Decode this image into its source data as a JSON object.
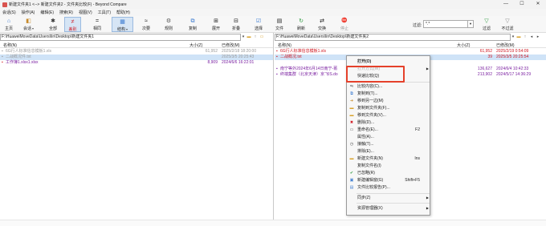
{
  "window": {
    "title": "新建文件夹1 <--> 新建文件夹2 - 文件夹比较(F) - Beyond Compare",
    "minimize": "—",
    "maximize": "☐",
    "close": "✕"
  },
  "menu": [
    "会话(S)",
    "操作(A)",
    "编辑(E)",
    "搜索(R)",
    "视图(V)",
    "工具(T)",
    "帮助(H)"
  ],
  "toolbar": [
    {
      "label": "主页",
      "icon": "home-icon",
      "glyph": "⌂"
    },
    {
      "label": "会话",
      "icon": "session-icon",
      "glyph": "◧",
      "caret": true
    },
    {
      "label": "全部",
      "icon": "all-icon",
      "glyph": "✱"
    },
    {
      "label": "差别",
      "icon": "diff-icon",
      "glyph": "≠",
      "active": true
    },
    {
      "label": "相同",
      "icon": "same-icon",
      "glyph": "="
    },
    {
      "label": "结构",
      "icon": "structure-icon",
      "glyph": "▦",
      "caret": true
    },
    {
      "label": "次要",
      "icon": "minor-icon",
      "glyph": "≈"
    },
    {
      "label": "规则",
      "icon": "rules-icon",
      "glyph": "⚙"
    },
    {
      "label": "复制",
      "icon": "copy-icon",
      "glyph": "⧉"
    },
    {
      "label": "展开",
      "icon": "expand-icon",
      "glyph": "⊞"
    },
    {
      "label": "折叠",
      "icon": "collapse-icon",
      "glyph": "⊟"
    },
    {
      "label": "选择",
      "icon": "select-icon",
      "glyph": "☑"
    },
    {
      "label": "文件",
      "icon": "files-icon",
      "glyph": "▤"
    },
    {
      "label": "刷新",
      "icon": "refresh-icon",
      "glyph": "↻"
    },
    {
      "label": "交换",
      "icon": "swap-icon",
      "glyph": "⇄"
    },
    {
      "label": "停止",
      "icon": "stop-icon",
      "glyph": "⛔"
    },
    {
      "label": "过滤",
      "icon": "filter-icon",
      "glyph": "▽"
    },
    {
      "label": "不过滤",
      "icon": "unfilter-icon",
      "glyph": "▽"
    }
  ],
  "filter": {
    "label": "过滤:",
    "value": "*.*",
    "dropdown": "▼"
  },
  "left": {
    "path": "F:\\HuaweiMoveData\\Users\\lin\\Desktop\\新建文件夹1",
    "headers": {
      "name": "名称(N)",
      "size": "大小(Z)",
      "modified": "已修改(M)"
    },
    "rows": [
      {
        "name": "6G行人标准信息模板1.xls",
        "size": "61,952",
        "modified": "2025/2/18 18:20:00",
        "color": "gray"
      },
      {
        "name": "二战概况件.txt",
        "size": "",
        "modified": "2025/3/5 20:25:43",
        "color": "gray",
        "selected": true
      },
      {
        "name": "工作簿1.xlsx1.xlsx",
        "size": "8,909",
        "modified": "2024/6/6 16:22:01",
        "color": "purple"
      }
    ]
  },
  "right": {
    "path": "F:\\HuaweiMoveData\\Users\\lin\\Desktop\\新建文件夹2",
    "headers": {
      "name": "名称(N)",
      "size": "大小(Z)",
      "modified": "已修改(M)"
    },
    "rows": [
      {
        "name": "6G行人标准信息模板1.xls",
        "size": "61,952",
        "modified": "2025/2/19 0:54:09",
        "color": "red"
      },
      {
        "name": "二战概况.txt",
        "size": "39",
        "modified": "2025/3/5 20:25:54",
        "color": "red",
        "selected": true
      },
      {
        "name": "南宁等外2024年6月14日南宁-莆",
        "size": "136,627",
        "modified": "2024/6/4 10:42:33",
        "color": "purple"
      },
      {
        "name": "终端集群（北京天津）京飞IS.do",
        "size": "213,902",
        "modified": "2024/5/17 14:36:29",
        "color": "purple"
      }
    ]
  },
  "context_menu": [
    {
      "label": "打开(O)",
      "bold": true
    },
    {
      "label": "打开方式(W)",
      "arrow": true,
      "disabled": true
    },
    {
      "label": "快速比较(Q)"
    },
    {
      "sep": true
    },
    {
      "label": "比较内容(C)...",
      "icon": "compare-icon"
    },
    {
      "label": "复制到(T)...",
      "icon": "copy-to-icon"
    },
    {
      "label": "移到另一边(M)",
      "icon": "move-other-icon"
    },
    {
      "label": "复制到文件夹(F)...",
      "icon": "copy-folder-icon"
    },
    {
      "label": "移到文件夹(V)...",
      "icon": "move-folder-icon"
    },
    {
      "label": "删除(D)...",
      "icon": "delete-icon"
    },
    {
      "label": "重命名(E)...",
      "shortcut": "F2",
      "icon": "rename-icon"
    },
    {
      "label": "属性(A)..."
    },
    {
      "label": "接触(T)...",
      "icon": "touch-icon"
    },
    {
      "label": "排除(E)..."
    },
    {
      "label": "新建文件夹(N)",
      "shortcut": "Ins",
      "icon": "new-folder-icon"
    },
    {
      "label": "复制文件名(I)"
    },
    {
      "label": "已忽略(R)",
      "icon": "check-icon"
    },
    {
      "label": "新建编辑窗(G)",
      "shortcut": "Shift+F5",
      "icon": "new-window-icon"
    },
    {
      "label": "文件比较报告(P)...",
      "icon": "report-icon"
    },
    {
      "sep": true
    },
    {
      "label": "同步(Z)",
      "arrow": true
    },
    {
      "sep": true
    },
    {
      "label": "资源管理器(X)",
      "arrow": true
    }
  ],
  "colors": {
    "highlight": "#e5412b",
    "selection": "#cfe3f7",
    "diff_red": "#d0161f",
    "orphan_purple": "#7a1fa0"
  }
}
